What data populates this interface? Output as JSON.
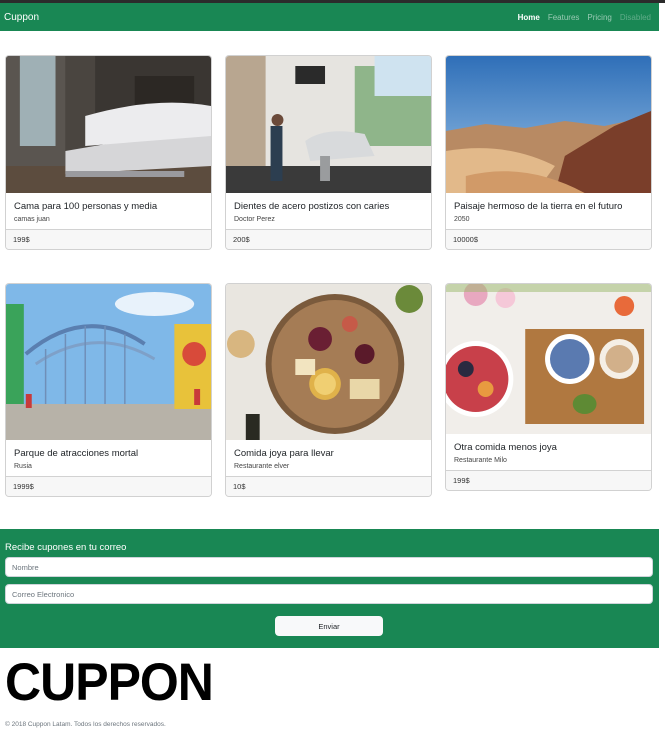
{
  "navbar": {
    "brand": "Cuppon",
    "links": [
      "Home",
      "Features",
      "Pricing",
      "Disabled"
    ]
  },
  "cards": [
    {
      "title": "Cama para 100 personas y media",
      "subtitle": "camas juan",
      "price": "199$",
      "image": "bedroom-photo"
    },
    {
      "title": "Dientes de acero postizos con caries",
      "subtitle": "Doctor Perez",
      "price": "200$",
      "image": "dental-clinic-photo"
    },
    {
      "title": "Paisaje hermoso de la tierra en el futuro",
      "subtitle": "2050",
      "price": "10000$",
      "image": "desert-landscape-photo"
    },
    {
      "title": "Parque de atracciones mortal",
      "subtitle": "Rusia",
      "price": "1999$",
      "image": "amusement-park-photo"
    },
    {
      "title": "Comida joya para llevar",
      "subtitle": "Restaurante elver",
      "price": "10$",
      "image": "food-platter-photo"
    },
    {
      "title": "Otra comida menos joya",
      "subtitle": "Restaurante Milo",
      "price": "199$",
      "image": "breakfast-table-photo"
    }
  ],
  "subscribe": {
    "heading": "Recibe cupones en tu correo",
    "name_placeholder": "Nombre",
    "email_placeholder": "Correo Electronico",
    "button": "Enviar"
  },
  "footer": {
    "logo": "CUPPON",
    "copyright": "© 2018 Cuppon Latam. Todos los derechos reservados."
  },
  "colors": {
    "brand_green": "#198754"
  }
}
